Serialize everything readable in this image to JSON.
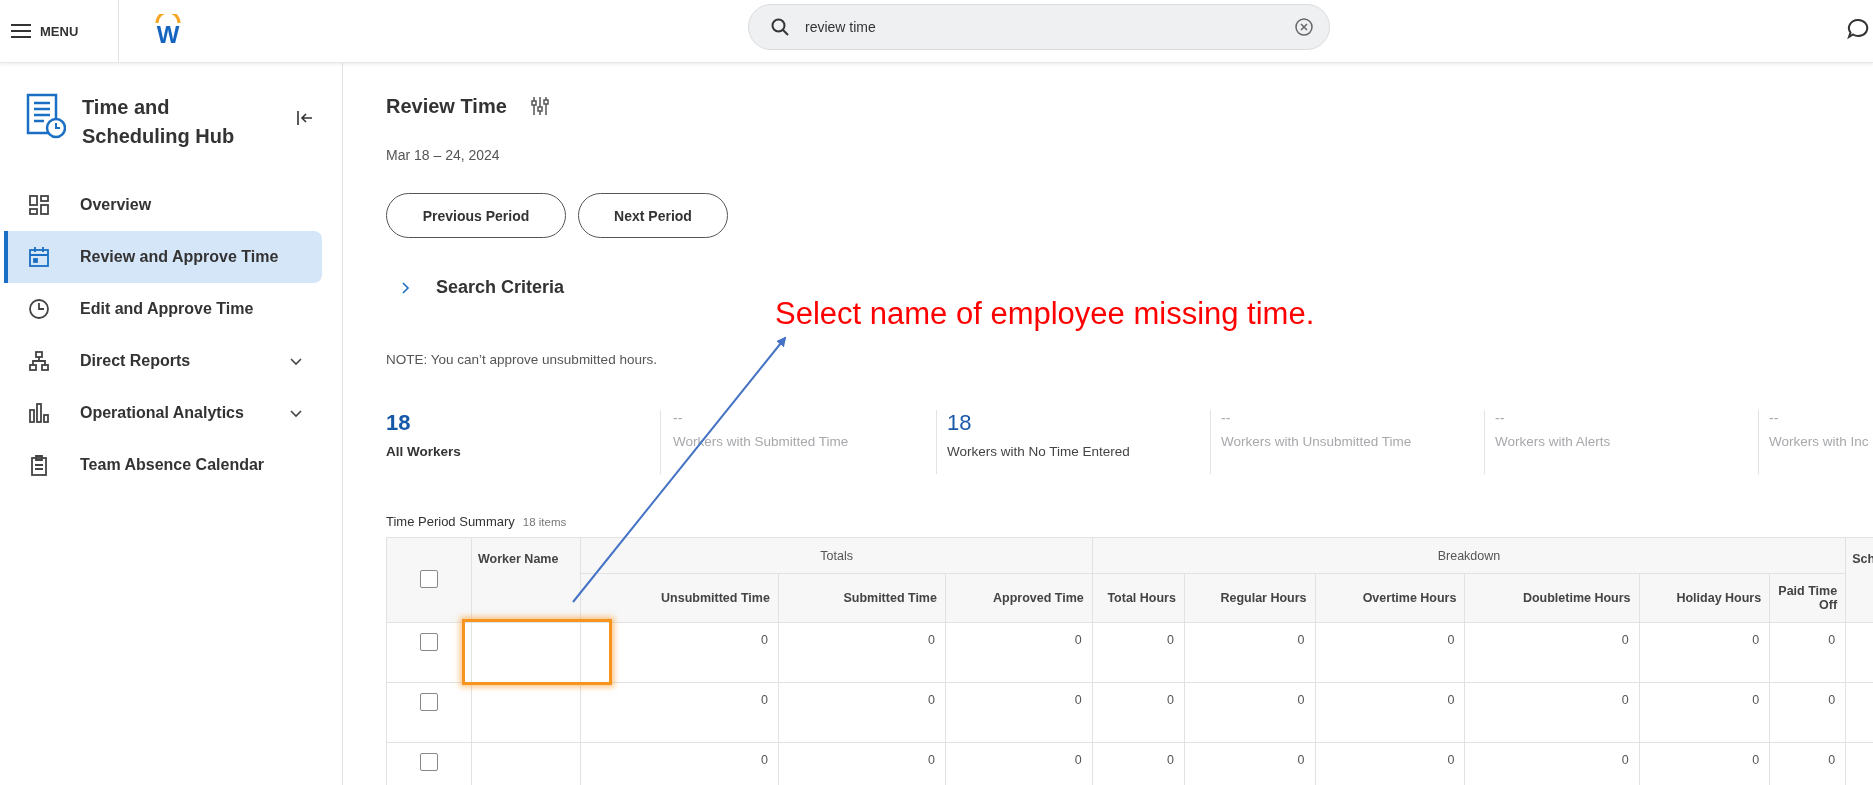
{
  "topbar": {
    "menu_label": "MENU",
    "logo": "W",
    "search": {
      "value": "review time"
    }
  },
  "sidebar": {
    "title": "Time and Scheduling Hub",
    "items": [
      {
        "label": "Overview",
        "selected": false
      },
      {
        "label": "Review and Approve Time",
        "selected": true
      },
      {
        "label": "Edit and Approve Time",
        "selected": false
      },
      {
        "label": "Direct Reports",
        "selected": false,
        "expanded": false
      },
      {
        "label": "Operational Analytics",
        "selected": false,
        "expanded": false
      },
      {
        "label": "Team Absence Calendar",
        "selected": false
      }
    ]
  },
  "page": {
    "title": "Review Time",
    "date_range": "Mar 18 – 24, 2024",
    "buttons": [
      "Previous Period",
      "Next Period"
    ],
    "search_criteria": {
      "label": "Search Criteria",
      "expanded": false
    },
    "note": "NOTE: You can’t approve unsubmitted hours.",
    "metrics": [
      {
        "kind": "primary",
        "value": "18",
        "label": "All Workers"
      },
      {
        "kind": "empty",
        "value": "--",
        "label": "Workers with Submitted Time"
      },
      {
        "kind": "value",
        "value": "18",
        "label": "Workers with No Time Entered"
      },
      {
        "kind": "empty",
        "value": "--",
        "label": "Workers with Unsubmitted Time"
      },
      {
        "kind": "empty",
        "value": "--",
        "label": "Workers with Alerts"
      },
      {
        "kind": "empty",
        "value": "--",
        "label": "Workers with Inc"
      }
    ]
  },
  "table": {
    "title": "Time Period Summary",
    "count": "18 items",
    "groups": [
      "Totals",
      "Breakdown"
    ],
    "worker_column": "Worker Name",
    "all_checked": false,
    "columns": [
      "Unsubmitted Time",
      "Submitted Time",
      "Approved Time",
      "Total Hours",
      "Regular Hours",
      "Overtime Hours",
      "Doubletime Hours",
      "Holiday Hours",
      "Paid Time Off"
    ],
    "column_cut": "Sch",
    "rows": [
      {
        "checked": false,
        "values": [
          "0",
          "0",
          "0",
          "0",
          "0",
          "0",
          "0",
          "0",
          "0"
        ]
      },
      {
        "checked": false,
        "values": [
          "0",
          "0",
          "0",
          "0",
          "0",
          "0",
          "0",
          "0",
          "0"
        ]
      },
      {
        "checked": false,
        "values": [
          "0",
          "0",
          "0",
          "0",
          "0",
          "0",
          "0",
          "0",
          "0"
        ]
      }
    ]
  },
  "annotation": {
    "text": "Select name of employee missing time."
  }
}
